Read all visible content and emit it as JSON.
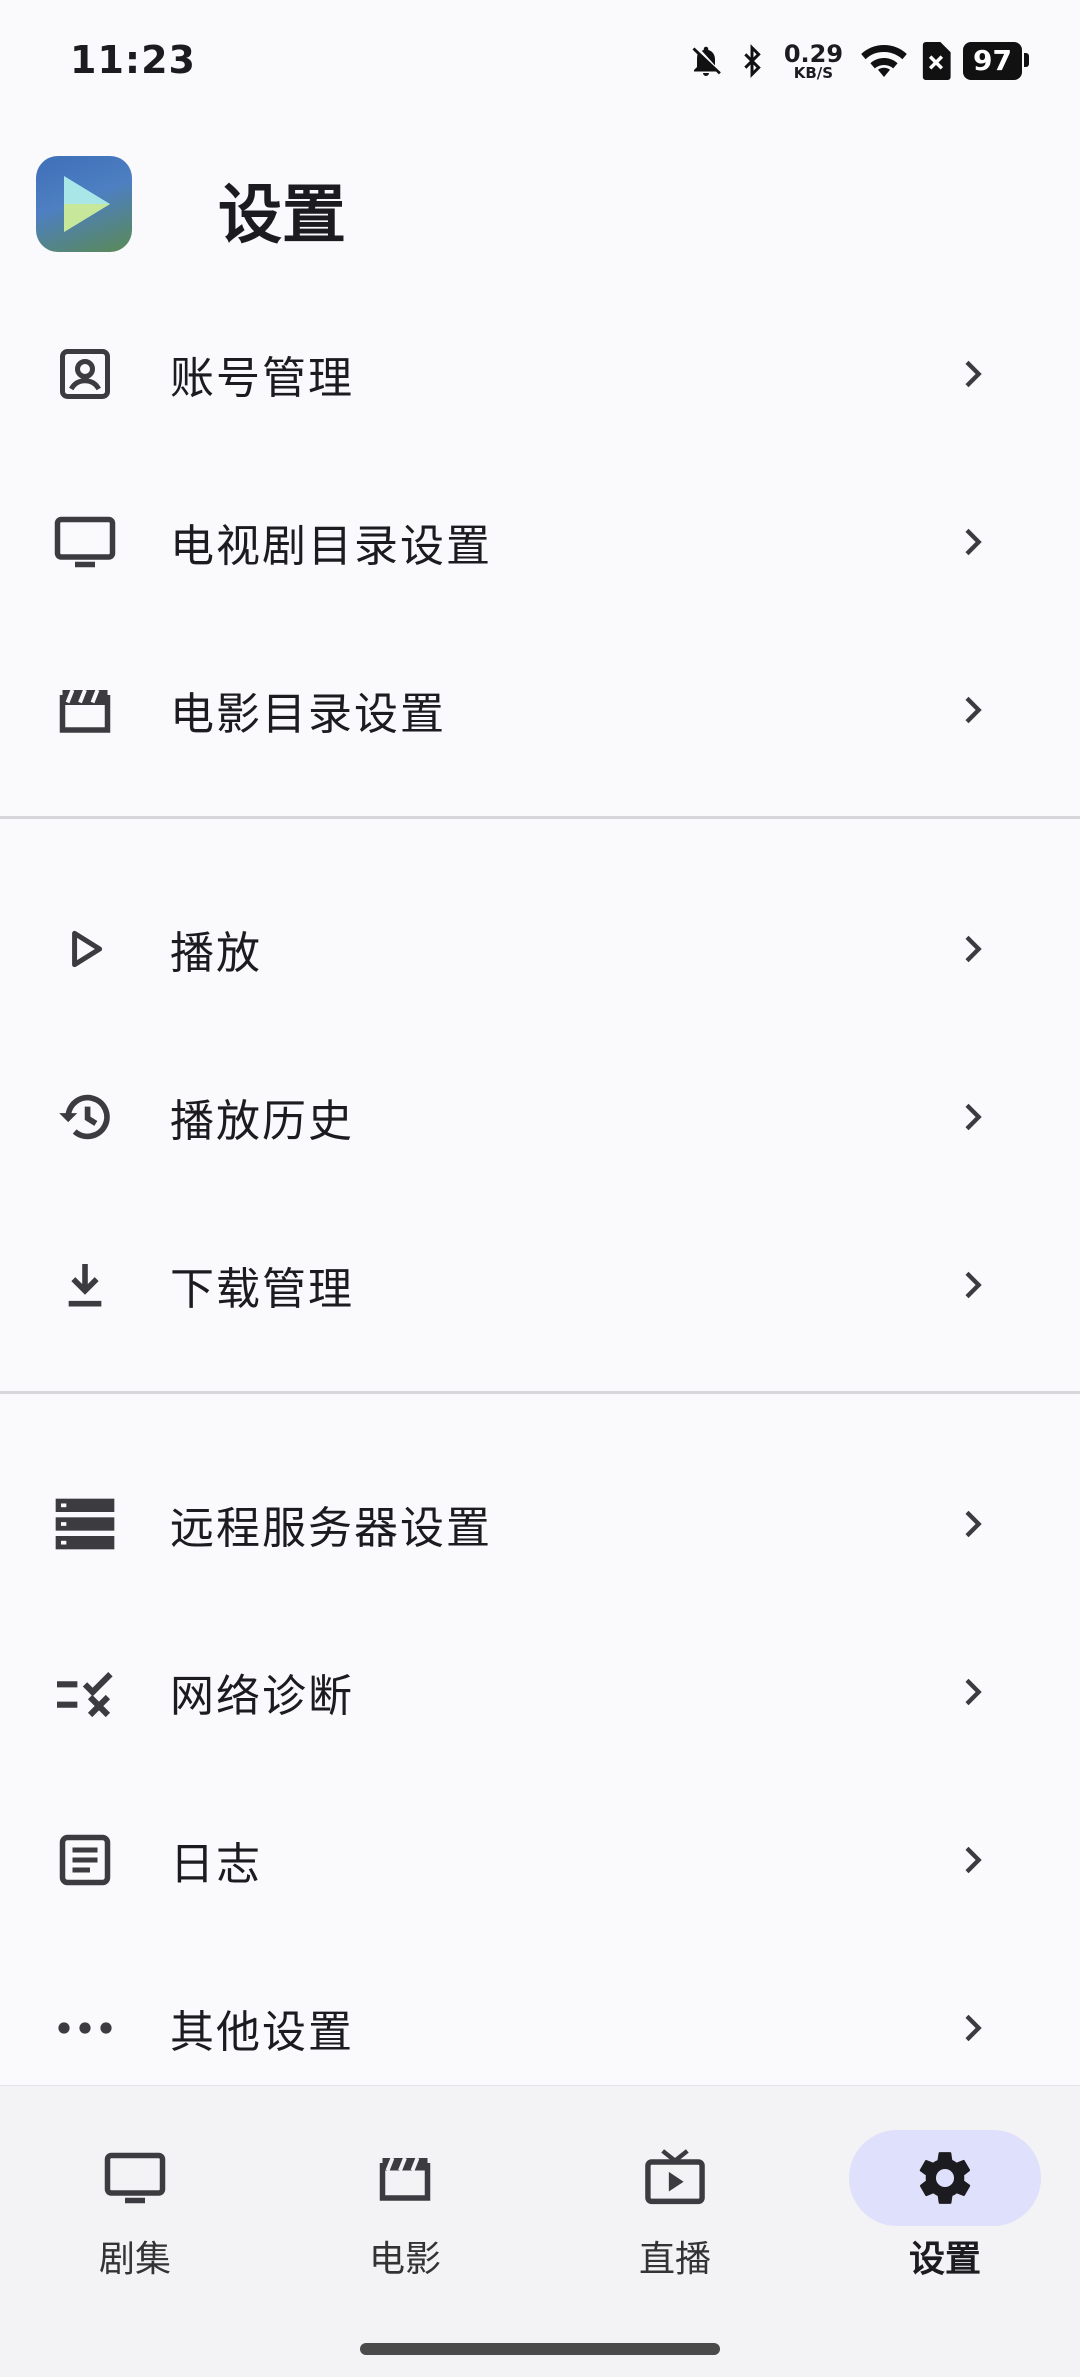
{
  "status_bar": {
    "time": "11:23",
    "net_speed_value": "0.29",
    "net_speed_unit": "KB/S",
    "battery": "97",
    "icons": [
      "bell-off-icon",
      "bluetooth-icon",
      "wifi-icon",
      "sim-error-icon",
      "battery-icon"
    ]
  },
  "app_bar": {
    "title": "设置",
    "logo_icon": "play-logo-icon"
  },
  "settings": {
    "groups": [
      [
        {
          "label": "账号管理",
          "icon": "account-box-icon"
        },
        {
          "label": "电视剧目录设置",
          "icon": "tv-icon"
        },
        {
          "label": "电影目录设置",
          "icon": "movie-clapper-icon"
        }
      ],
      [
        {
          "label": "播放",
          "icon": "play-icon"
        },
        {
          "label": "播放历史",
          "icon": "history-icon"
        },
        {
          "label": "下载管理",
          "icon": "download-icon"
        }
      ],
      [
        {
          "label": "远程服务器设置",
          "icon": "server-icon"
        },
        {
          "label": "网络诊断",
          "icon": "rule-icon"
        },
        {
          "label": "日志",
          "icon": "article-icon"
        },
        {
          "label": "其他设置",
          "icon": "more-horiz-icon"
        }
      ]
    ]
  },
  "bottom_nav": {
    "items": [
      {
        "label": "剧集",
        "icon": "tv-icon",
        "active": false
      },
      {
        "label": "电影",
        "icon": "movie-clapper-icon",
        "active": false
      },
      {
        "label": "直播",
        "icon": "live-tv-icon",
        "active": false
      },
      {
        "label": "设置",
        "icon": "gear-icon",
        "active": true
      }
    ],
    "active_color": "#dfe0fb"
  }
}
